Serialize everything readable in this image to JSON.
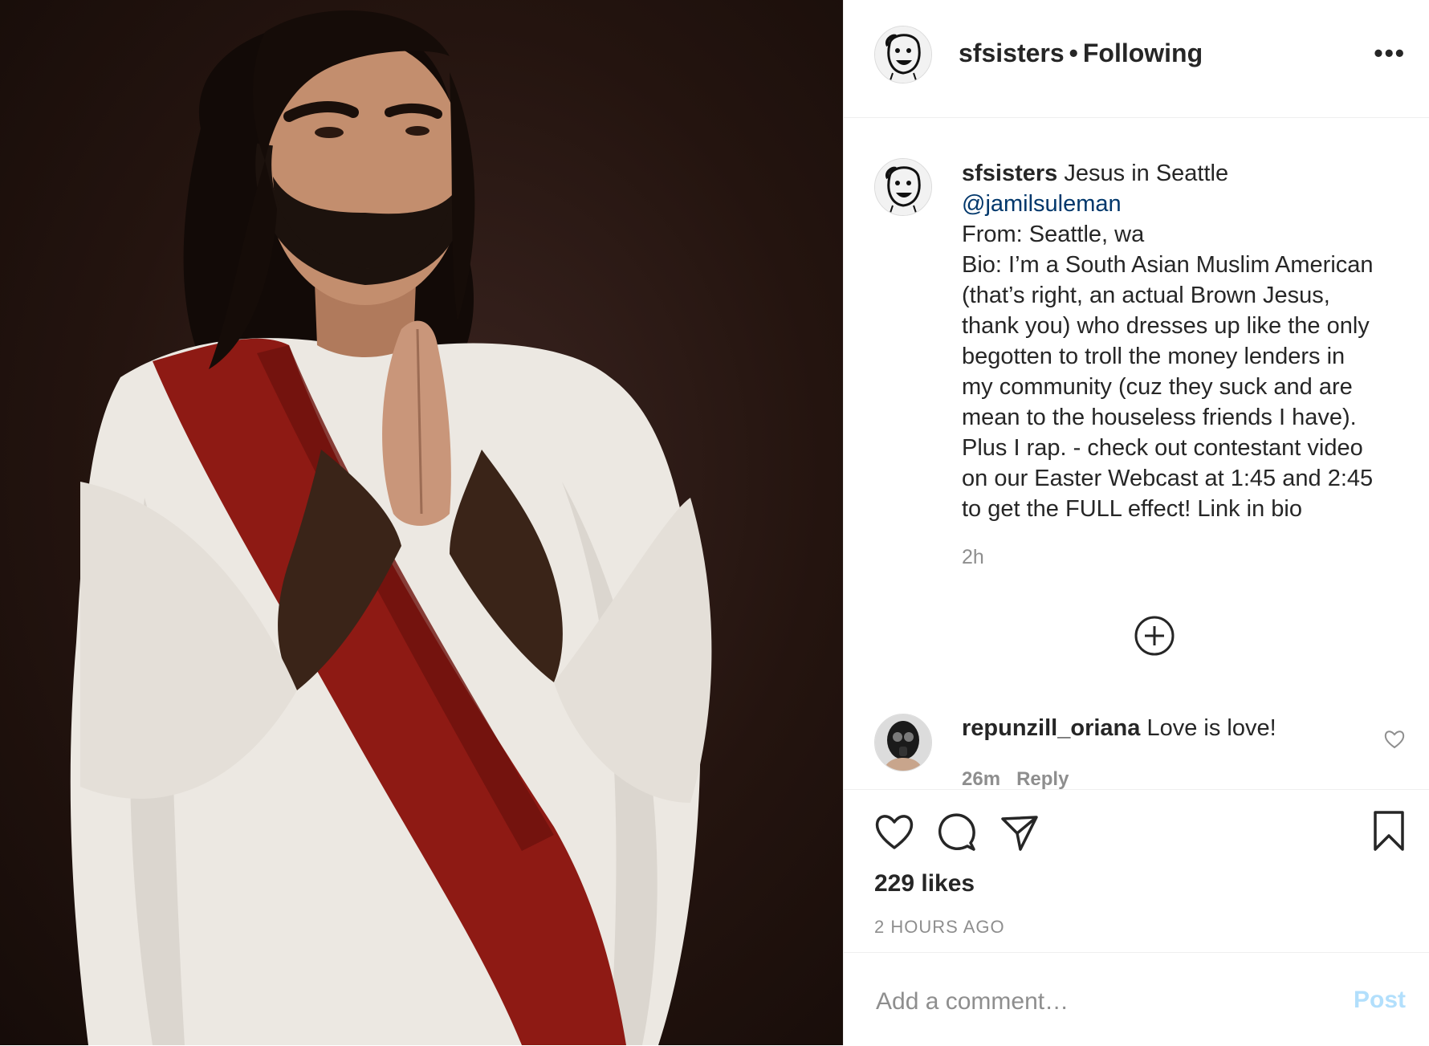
{
  "post": {
    "username": "sfsisters",
    "separator": "•",
    "follow_status": "Following",
    "more_label": "•••"
  },
  "caption": {
    "username": "sfsisters",
    "title": "Jesus in Seattle",
    "mention": "@jamilsuleman",
    "lines": [
      "From: Seattle, wa",
      "Bio: I’m a South Asian Muslim American",
      "(that’s right, an actual Brown Jesus,",
      "thank you) who dresses up like the only",
      "begotten to troll the money lenders in",
      "my community (cuz they suck and are",
      "mean to the houseless friends I have).",
      "Plus I rap. - check out contestant video",
      "on our Easter Webcast at 1:45 and 2:45",
      "to get the FULL effect! Link in bio"
    ],
    "time": "2h"
  },
  "comment": {
    "username": "repunzill_oriana",
    "text": "Love is love!",
    "time": "26m",
    "reply_label": "Reply"
  },
  "actions": {
    "likes": "229 likes",
    "posted_ago": "2 HOURS AGO",
    "icons": [
      "heart-icon",
      "comment-icon",
      "share-icon",
      "bookmark-icon"
    ]
  },
  "add_comment": {
    "placeholder": "Add a comment…",
    "post_label": "Post"
  },
  "colors": {
    "link": "#00376b",
    "muted": "#8e8e8e",
    "post_disabled": "#b2dffc",
    "sash": "#8e1a14",
    "robe": "#ece8e2"
  }
}
